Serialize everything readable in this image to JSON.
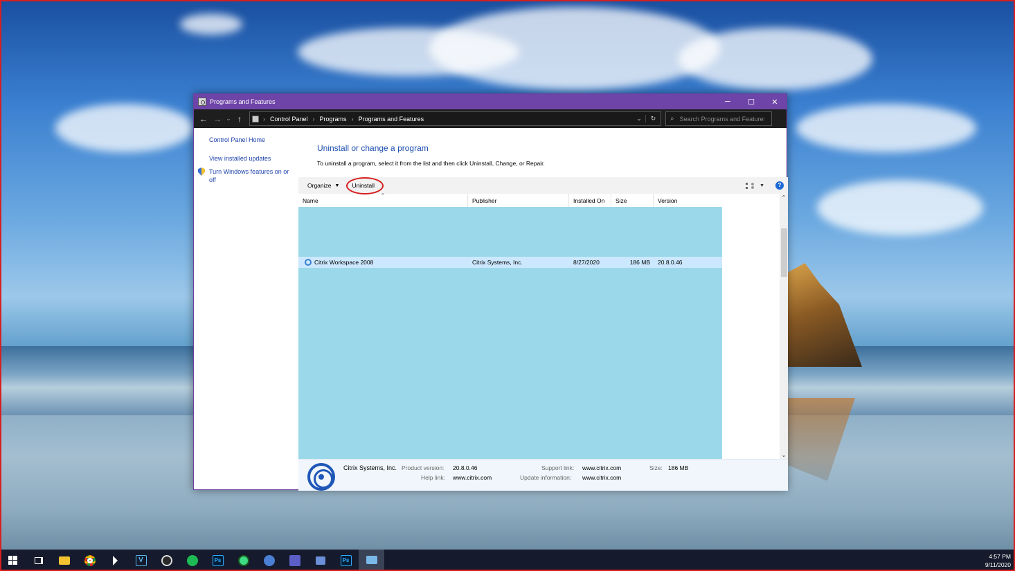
{
  "window": {
    "title": "Programs and Features",
    "controls": {
      "minimize": "─",
      "maximize": "☐",
      "close": "✕"
    }
  },
  "address_bar": {
    "back": "←",
    "forward": "→",
    "recent": "⌄",
    "up": "↑",
    "breadcrumbs": [
      "Control Panel",
      "Programs",
      "Programs and Features"
    ],
    "separator": "›",
    "dropdown": "⌄",
    "refresh": "↻"
  },
  "search": {
    "placeholder": "Search Programs and Features",
    "icon": "⌕"
  },
  "sidebar": {
    "home": "Control Panel Home",
    "updates": "View installed updates",
    "features": "Turn Windows features on or off"
  },
  "main": {
    "title": "Uninstall or change a program",
    "description": "To uninstall a program, select it from the list and then click Uninstall, Change, or Repair."
  },
  "toolbar": {
    "organize": "Organize",
    "organize_caret": "▼",
    "uninstall": "Uninstall",
    "view_caret": "▼",
    "help": "?"
  },
  "columns": [
    "Name",
    "Publisher",
    "Installed On",
    "Size",
    "Version"
  ],
  "sort_arrow": "^",
  "programs": [
    {
      "name": "Citrix Workspace 2008",
      "publisher": "Citrix Systems, Inc.",
      "installed_on": "8/27/2020",
      "size": "186 MB",
      "version": "20.8.0.46"
    }
  ],
  "scroll": {
    "up": "⌃",
    "down": "⌄"
  },
  "details": {
    "publisher": "Citrix Systems, Inc.",
    "product_version_label": "Product version:",
    "product_version": "20.8.0.46",
    "help_link_label": "Help link:",
    "help_link": "www.citrix.com",
    "support_link_label": "Support link:",
    "support_link": "www.citrix.com",
    "update_info_label": "Update information:",
    "update_info": "www.citrix.com",
    "size_label": "Size:",
    "size": "186 MB"
  },
  "taskbar": {
    "icons": [
      "windows-start",
      "task-view",
      "file-explorer",
      "chrome",
      "unity",
      "vegas",
      "obs",
      "spotify",
      "photoshop",
      "android-studio",
      "vsee",
      "teams",
      "remote-desktop",
      "photoshop-2",
      "control-panel"
    ],
    "vegas_label": "V",
    "ps_label": "Ps",
    "time": "4:57 PM",
    "date": "9/11/2020"
  },
  "colors": {
    "titlebar": "#6e44a8",
    "link": "#1a3fa8",
    "title_text": "#1d4fb0",
    "list_bg": "#9bd9ea",
    "selected_row": "#cce8ff",
    "highlight_circle": "#d81e1e"
  }
}
